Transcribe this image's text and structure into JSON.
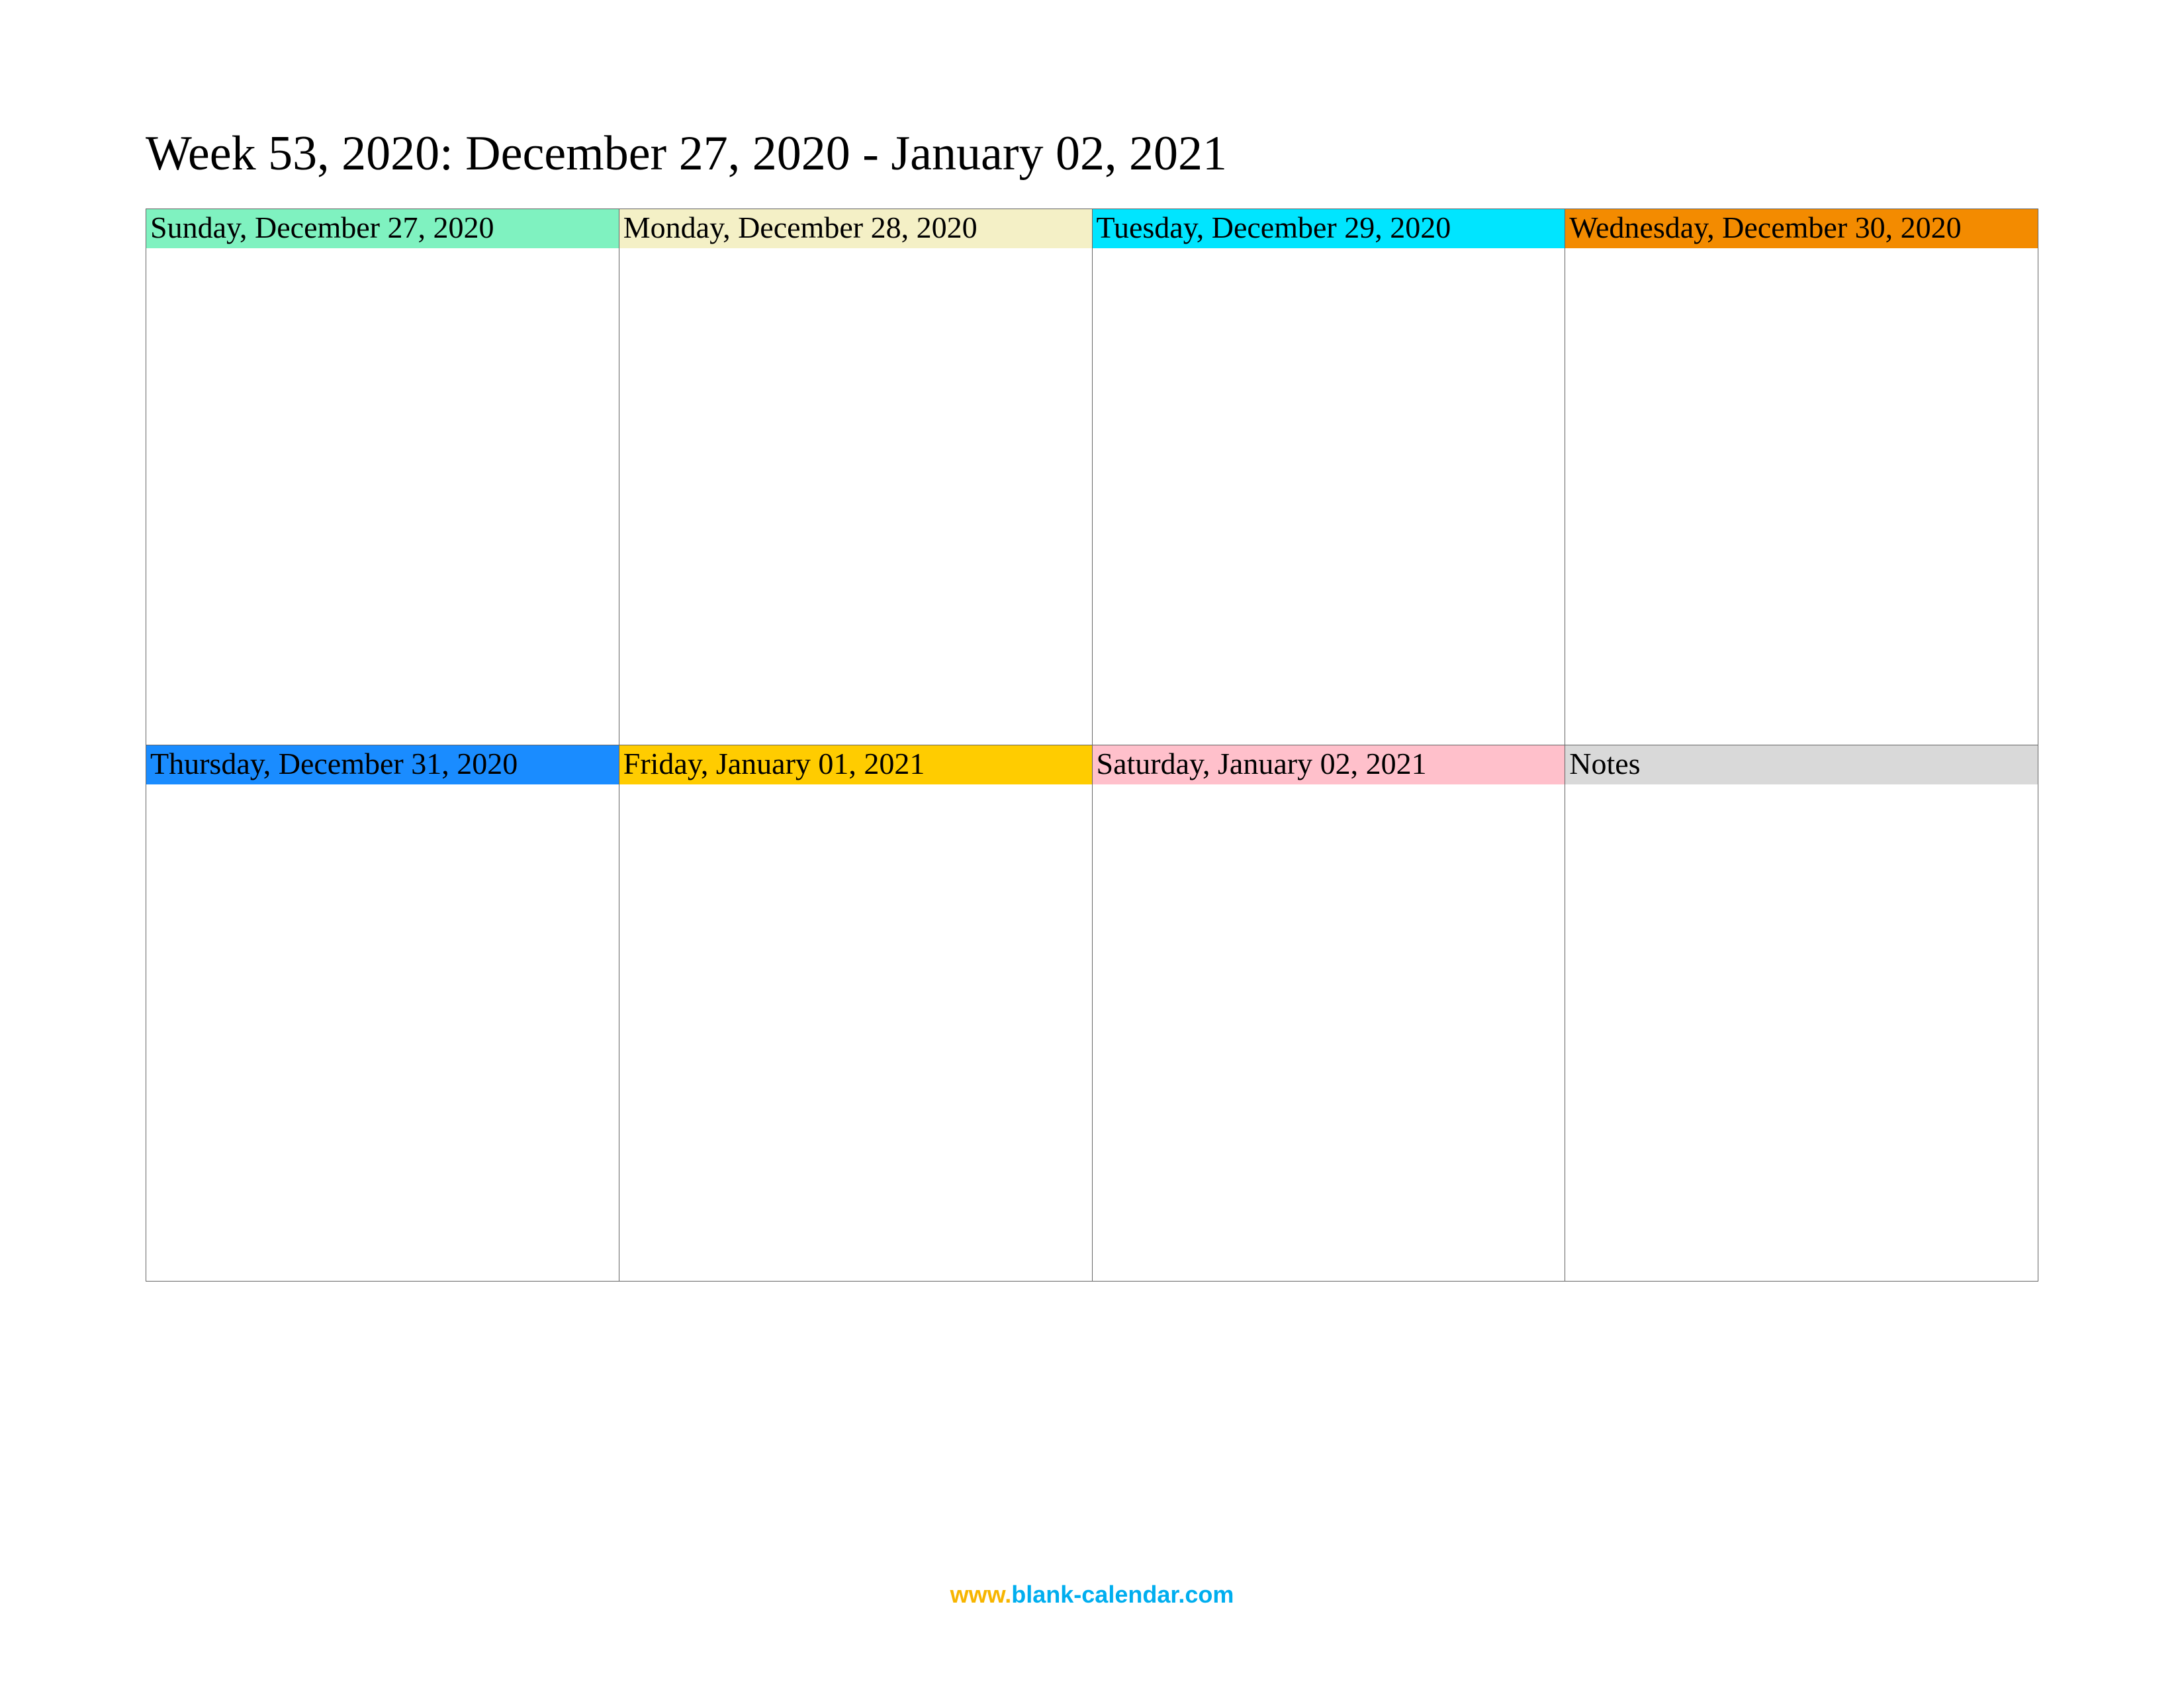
{
  "title": "Week 53, 2020: December 27, 2020 - January 02, 2021",
  "cells": [
    {
      "label": "Sunday, December 27, 2020",
      "bg": "#7ff2c0"
    },
    {
      "label": "Monday, December 28, 2020",
      "bg": "#f4f0c6"
    },
    {
      "label": "Tuesday, December 29, 2020",
      "bg": "#00e5ff"
    },
    {
      "label": "Wednesday, December 30, 2020",
      "bg": "#f38b00"
    },
    {
      "label": "Thursday, December 31, 2020",
      "bg": "#1a8cff"
    },
    {
      "label": "Friday, January 01, 2021",
      "bg": "#ffcc00"
    },
    {
      "label": "Saturday, January 02, 2021",
      "bg": "#ffc0cb"
    },
    {
      "label": "Notes",
      "bg": "#d9d9d9"
    }
  ],
  "footer": {
    "www": "www.",
    "domain": "blank-calendar.com"
  }
}
